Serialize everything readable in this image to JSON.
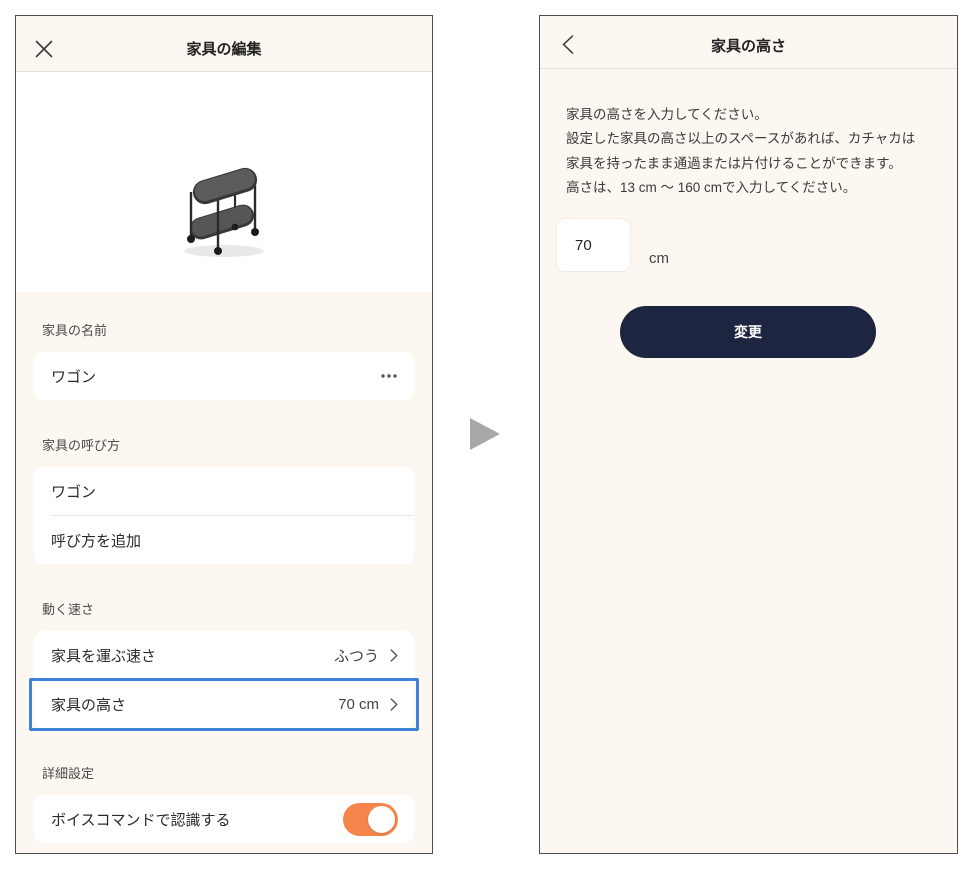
{
  "colors": {
    "background": "#fcf7f1",
    "card": "#ffffff",
    "text": "#2a2a2a",
    "muted": "#4a4a4a",
    "accent_orange": "#f5854b",
    "highlight_blue": "#3f81da",
    "button_navy": "#1d2541",
    "arrow_gray": "#a8a8a8"
  },
  "edit_screen": {
    "header": {
      "title": "家具の編集",
      "close_icon": "close-icon"
    },
    "image": {
      "icon": "wagon-image"
    },
    "name_section": {
      "label": "家具の名前",
      "value": "ワゴン",
      "more_icon": "more-dots-icon"
    },
    "call_section": {
      "label": "家具の呼び方",
      "items": [
        {
          "label": "ワゴン"
        },
        {
          "label": "呼び方を追加"
        }
      ]
    },
    "speed_section": {
      "label": "動く速さ",
      "rows": [
        {
          "label": "家具を運ぶ速さ",
          "value": "ふつう",
          "icon": "chevron-right-icon"
        },
        {
          "label": "家具の高さ",
          "value": "70 cm",
          "icon": "chevron-right-icon",
          "highlighted": true
        }
      ]
    },
    "advanced_section": {
      "label": "詳細設定",
      "rows": [
        {
          "label": "ボイスコマンドで認識する",
          "toggle_on": true
        }
      ]
    }
  },
  "transition_icon": "play-triangle-icon",
  "height_screen": {
    "header": {
      "title": "家具の高さ",
      "back_icon": "chevron-left-icon"
    },
    "description_lines": [
      "家具の高さを入力してください。",
      "設定した家具の高さ以上のスペースがあれば、カチャカは",
      "家具を持ったまま通過または片付けることができます。",
      "高さは、13 cm 〜 160 cmで入力してください。"
    ],
    "height_input": {
      "value": "70",
      "unit": "cm"
    },
    "submit_button": {
      "label": "変更"
    }
  }
}
